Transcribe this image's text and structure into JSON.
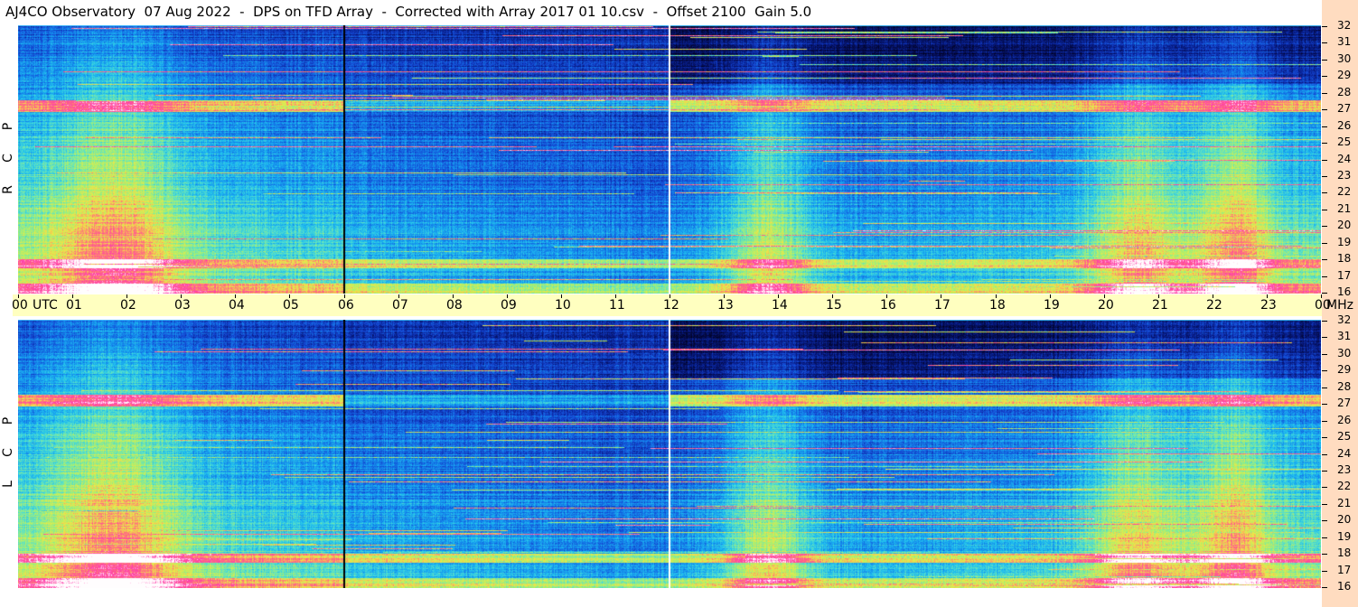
{
  "header": {
    "title": "AJ4CO Observatory  07 Aug 2022  -  DPS on TFD Array  -  Corrected with Array 2017 01 10.csv  -  Offset 2100  Gain 5.0"
  },
  "colors": {
    "background_low": "#000020",
    "low": "#0a2a9a",
    "mid": "#1aa0e8",
    "high": "#a8f060",
    "peak": "#ff40a0",
    "time_axis_band": "#ffffc0",
    "freq_axis_band": "#ffdcc0"
  },
  "chart_data": {
    "type": "heatmap",
    "description_units": "time in UTC hours (x), frequency in MHz (y)",
    "x_ticks": [
      "00",
      "UTC",
      "01",
      "02",
      "03",
      "04",
      "05",
      "06",
      "07",
      "08",
      "09",
      "10",
      "11",
      "12",
      "13",
      "14",
      "15",
      "16",
      "17",
      "18",
      "19",
      "20",
      "21",
      "22",
      "23",
      "00",
      "MHz"
    ],
    "x_range_hours": [
      0,
      24
    ],
    "y_ticks": [
      "32",
      "31",
      "30",
      "29",
      "28",
      "27",
      "26",
      "25",
      "24",
      "23",
      "22",
      "21",
      "20",
      "19",
      "18",
      "17",
      "16"
    ],
    "y_range_mhz": [
      16,
      32
    ],
    "panels": [
      {
        "name": "RCP",
        "label_letters": [
          "P",
          "C",
          "R"
        ]
      },
      {
        "name": "LCP",
        "label_letters": [
          "P",
          "C",
          "L"
        ]
      }
    ],
    "marker_times_utc_hours": [
      6,
      12
    ]
  }
}
